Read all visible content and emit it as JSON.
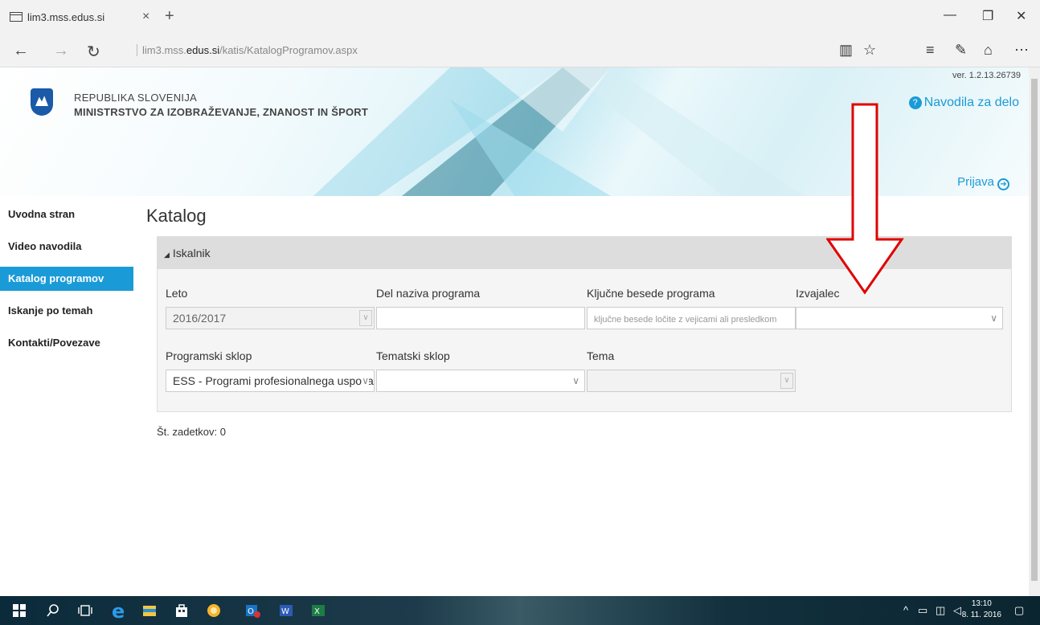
{
  "browser": {
    "tab_title": "lim3.mss.edus.si",
    "tab_close": "×",
    "new_tab": "+",
    "url_prefix": "lim3.mss.",
    "url_domain": "edus.si",
    "url_path": "/katis/KatalogProgramov.aspx",
    "minimize": "—",
    "maximize": "❐",
    "close": "✕"
  },
  "banner": {
    "org_line1": "REPUBLIKA SLOVENIJA",
    "org_line2": "MINISTRSTVO ZA IZOBRAŽEVANJE, ZNANOST IN ŠPORT",
    "version": "ver. 1.2.13.26739",
    "help_link": "Navodila za delo",
    "login_link": "Prijava"
  },
  "sidebar": {
    "items": [
      {
        "label": "Uvodna stran"
      },
      {
        "label": "Video navodila"
      },
      {
        "label": "Katalog programov"
      },
      {
        "label": "Iskanje po temah"
      },
      {
        "label": "Kontakti/Povezave"
      }
    ]
  },
  "main": {
    "title": "Katalog",
    "panel_header": "Iskalnik",
    "fields": {
      "leto_label": "Leto",
      "leto_value": "2016/2017",
      "del_naziva_label": "Del naziva programa",
      "del_naziva_value": "",
      "kljucne_label": "Ključne besede programa",
      "kljucne_placeholder": "ključne besede ločite z vejicami ali presledkom",
      "izvajalec_label": "Izvajalec",
      "izvajalec_value": "",
      "programski_label": "Programski sklop",
      "programski_value": "ESS - Programi profesionalnega usposabljanja",
      "tematski_label": "Tematski sklop",
      "tematski_value": "",
      "tema_label": "Tema",
      "tema_value": ""
    },
    "result_count": "Št. zadetkov: 0"
  },
  "taskbar": {
    "time": "13:10",
    "date": "8. 11. 2016"
  },
  "colors": {
    "accent": "#1a9bd7",
    "arrow": "#e00000"
  }
}
